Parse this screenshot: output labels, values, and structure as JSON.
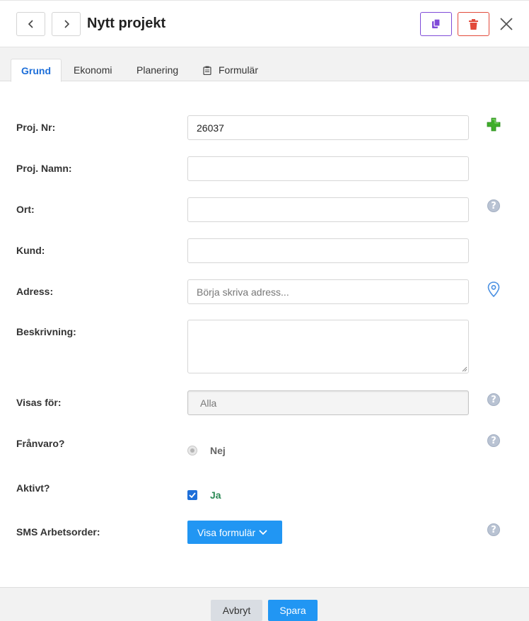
{
  "header": {
    "title": "Nytt projekt",
    "back_icon": "chevron-left-icon",
    "forward_icon": "chevron-right-icon",
    "copy_icon": "copy-icon",
    "delete_icon": "trash-icon",
    "close_icon": "close-icon",
    "copy_color": "#7f4bd8",
    "delete_color": "#e24a3b"
  },
  "tabs": [
    {
      "label": "Grund",
      "active": true
    },
    {
      "label": "Ekonomi",
      "active": false
    },
    {
      "label": "Planering",
      "active": false
    },
    {
      "label": "Formulär",
      "active": false,
      "icon": "clipboard-icon"
    }
  ],
  "form": {
    "proj_nr": {
      "label": "Proj. Nr:",
      "value": "26037",
      "action_icon": "plus-icon"
    },
    "proj_namn": {
      "label": "Proj. Namn:",
      "value": ""
    },
    "ort": {
      "label": "Ort:",
      "value": "",
      "help_icon": "help-icon"
    },
    "kund": {
      "label": "Kund:",
      "value": ""
    },
    "adress": {
      "label": "Adress:",
      "placeholder": "Börja skriva adress...",
      "action_icon": "map-pin-icon"
    },
    "beskrivning": {
      "label": "Beskrivning:",
      "value": ""
    },
    "visas_for": {
      "label": "Visas för:",
      "value": "Alla",
      "help_icon": "help-icon"
    },
    "franvaro": {
      "label": "Frånvaro?",
      "option": "Nej",
      "selected": true,
      "help_icon": "help-icon"
    },
    "aktivt": {
      "label": "Aktivt?",
      "option": "Ja",
      "checked": true
    },
    "sms": {
      "label": "SMS Arbetsorder:",
      "button": "Visa formulär",
      "button_icon": "chevron-down-icon",
      "help_icon": "help-icon"
    }
  },
  "help_glyph": "?",
  "footer": {
    "cancel_label": "Avbryt",
    "save_label": "Spara"
  },
  "colors": {
    "primary": "#2196f3",
    "active_tab": "#1e6fd9",
    "success_text": "#2e8b57"
  }
}
